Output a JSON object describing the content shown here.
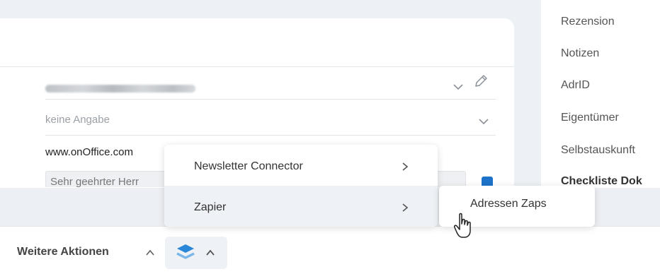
{
  "form": {
    "email_value": "",
    "salutation_type_placeholder": "keine Angabe",
    "website_value": "www.onOffice.com",
    "letter_salutation_value": "Sehr geehrter Herr"
  },
  "sidebar": {
    "items": [
      {
        "label": "Rezension"
      },
      {
        "label": "Notizen"
      },
      {
        "label": "AdrID"
      },
      {
        "label": "Eigentümer"
      },
      {
        "label": "Selbstauskunft"
      },
      {
        "label": "Checkliste Dok"
      }
    ]
  },
  "bottom_bar": {
    "more_actions_label": "Weitere Aktionen"
  },
  "context_menu": {
    "items": [
      {
        "label": "Newsletter Connector"
      },
      {
        "label": "Zapier"
      }
    ],
    "submenu": {
      "items": [
        {
          "label": "Adressen Zaps"
        }
      ]
    }
  },
  "colors": {
    "accent": "#1c73c9",
    "menu_hover": "#eef1f5",
    "background": "#edf0f4"
  },
  "icons": [
    "chevron-down-icon",
    "pencil-icon",
    "chevron-right-icon",
    "chevron-up-icon",
    "zapier-stack-icon",
    "hand-pointer-cursor"
  ]
}
